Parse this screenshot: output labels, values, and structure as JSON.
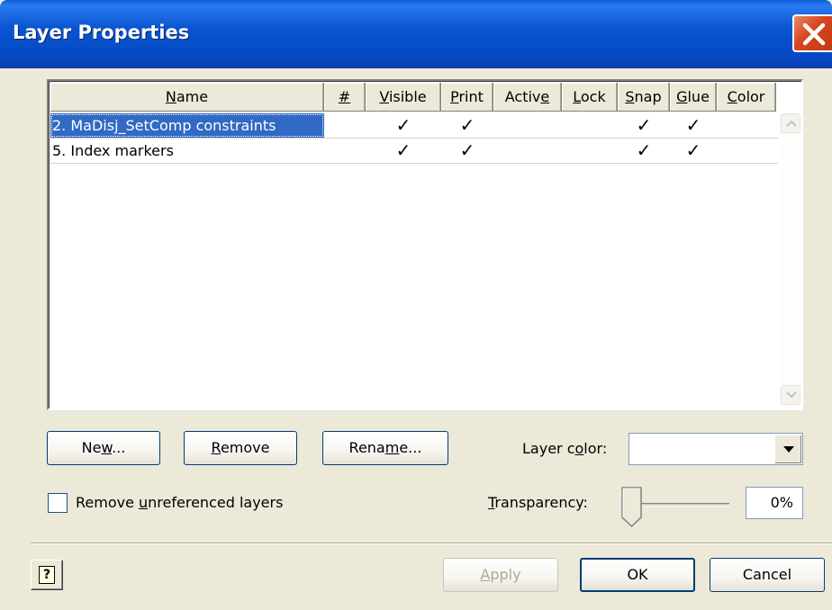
{
  "window": {
    "title": "Layer Properties"
  },
  "columns": [
    {
      "label": "Name",
      "mnemonic": "N"
    },
    {
      "label": "#",
      "mnemonic": "#"
    },
    {
      "label": "Visible",
      "mnemonic": "V"
    },
    {
      "label": "Print",
      "mnemonic": "P"
    },
    {
      "label": "Active",
      "mnemonic": "e"
    },
    {
      "label": "Lock",
      "mnemonic": "L"
    },
    {
      "label": "Snap",
      "mnemonic": "S"
    },
    {
      "label": "Glue",
      "mnemonic": "G"
    },
    {
      "label": "Color",
      "mnemonic": "C"
    }
  ],
  "layers": [
    {
      "name": "2. MaDisj_SetComp constraints",
      "number": "",
      "visible": true,
      "print": true,
      "active": false,
      "lock": false,
      "snap": true,
      "glue": true,
      "color": false,
      "selected": true
    },
    {
      "name": "5. Index markers",
      "number": "",
      "visible": true,
      "print": true,
      "active": false,
      "lock": false,
      "snap": true,
      "glue": true,
      "color": false,
      "selected": false
    }
  ],
  "buttons": {
    "new_label": "New...",
    "remove_label": "Remove",
    "rename_label": "Rename...",
    "apply_label": "Apply",
    "ok_label": "OK",
    "cancel_label": "Cancel"
  },
  "layer_color": {
    "label": "Layer color:",
    "value": ""
  },
  "remove_unreferenced": {
    "label": "Remove unreferenced layers",
    "checked": false
  },
  "transparency": {
    "label": "Transparency:",
    "value": "0%",
    "level": 0
  },
  "icons": {
    "close": "close-icon",
    "help": "help-icon",
    "check": "checkmark-icon",
    "dropdown": "chevron-down-icon"
  },
  "colors": {
    "titlebar": "#0a56d0",
    "selection": "#316ac5",
    "dialog_bg": "#ece9d8",
    "close_button": "#d6461c"
  }
}
